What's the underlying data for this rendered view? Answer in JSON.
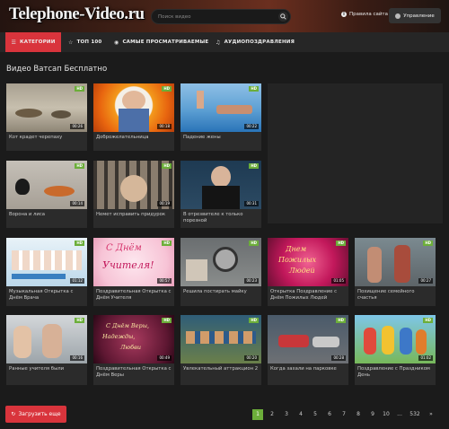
{
  "header": {
    "logo": "Telephone-Video.ru",
    "search_placeholder": "Поиск видео",
    "rules_label": "Правила сайта",
    "manage_label": "Управление"
  },
  "nav": {
    "categories": "КАТЕГОРИИ",
    "top100": "ТОП 100",
    "most_viewed": "САМЫЕ ПРОСМАТРИВАЕМЫЕ",
    "audio": "АУДИОПОЗДРАВЛЕНИЯ"
  },
  "section_title": "Видео Ватсап Бесплатно",
  "videos": [
    {
      "title": "Кот крадет черепаху",
      "badge": "HD",
      "duration": "00:26"
    },
    {
      "title": "Доброжелательница",
      "badge": "HD",
      "duration": "00:18"
    },
    {
      "title": "Падение жены",
      "badge": "HD",
      "duration": "00:22"
    },
    {
      "title": "Ворона и лиса",
      "badge": "HD",
      "duration": "00:14"
    },
    {
      "title": "Немет исправить придурок",
      "badge": "HD",
      "duration": "00:19"
    },
    {
      "title": "В отрезвителе к только порезной",
      "badge": "HD",
      "duration": "00:31"
    },
    {
      "title": "Музыкальная Открытка с Днём Врача",
      "badge": "HD",
      "duration": "01:12"
    },
    {
      "title": "Поздравительная Открытка с Днём Учителя",
      "badge": "HD",
      "duration": "00:57"
    },
    {
      "title": "Решила постирать майку",
      "badge": "HD",
      "duration": "00:23"
    },
    {
      "title": "Открытка Поздравление с Днём Пожилых Людей",
      "badge": "HD",
      "duration": "01:05"
    },
    {
      "title": "Похищение семейного счастья",
      "badge": "HD",
      "duration": "00:27"
    },
    {
      "title": "Ранные учителя были",
      "badge": "HD",
      "duration": "00:16"
    },
    {
      "title": "Поздравительная Открытка с Днём Веры",
      "badge": "HD",
      "duration": "00:49"
    },
    {
      "title": "Увлекательный аттракцион 2",
      "badge": "HD",
      "duration": "00:20"
    },
    {
      "title": "Когда захали на парковке",
      "badge": "HD",
      "duration": "00:28"
    },
    {
      "title": "Поздравление с Праздником День",
      "badge": "HD",
      "duration": "01:02"
    }
  ],
  "footer": {
    "load_more": "Загрузить еще",
    "pages": [
      "1",
      "2",
      "3",
      "4",
      "5",
      "6",
      "7",
      "8",
      "9",
      "10",
      "...",
      "532",
      "»"
    ],
    "active_page": "1"
  },
  "colors": {
    "accent": "#d9343c",
    "badge": "#6cae3a",
    "background": "#1b1b1b"
  }
}
